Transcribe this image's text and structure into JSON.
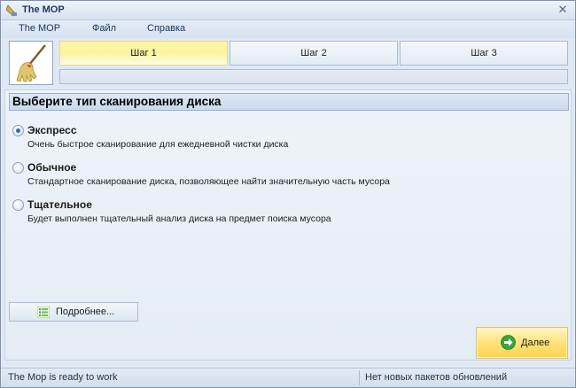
{
  "window": {
    "title": "The MOP"
  },
  "menu": {
    "items": [
      "The MOP",
      "Файл",
      "Справка"
    ]
  },
  "steps": [
    {
      "label": "Шаг 1",
      "active": true
    },
    {
      "label": "Шаг 2",
      "active": false
    },
    {
      "label": "Шаг 3",
      "active": false
    }
  ],
  "progress": {
    "value": 0
  },
  "section": {
    "title": "Выберите тип сканирования диска"
  },
  "scan_options": [
    {
      "title": "Экспресс",
      "description": "Очень быстрое сканирование для ежедневной чистки диска",
      "selected": true
    },
    {
      "title": "Обычное",
      "description": "Стандартное сканирование диска, позволяющее найти значительную часть мусора",
      "selected": false
    },
    {
      "title": "Тщательное",
      "description": "Будет выполнен тщательный анализ диска на предмет поиска мусора",
      "selected": false
    }
  ],
  "buttons": {
    "details_label": "Подробнее...",
    "next_label": "Далее"
  },
  "status": {
    "left": "The Mop is ready to work",
    "right": "Нет новых пакетов обновлений"
  },
  "icons": {
    "app": "mop-icon",
    "logo": "mop-logo-icon",
    "close": "close-icon",
    "details": "list-icon",
    "next": "arrow-right-icon"
  },
  "colors": {
    "active_tab": "#fdf4a0",
    "next_button": "#ffe27a",
    "accent_blue": "#2f6db5",
    "next_arrow": "#3aa53a"
  }
}
